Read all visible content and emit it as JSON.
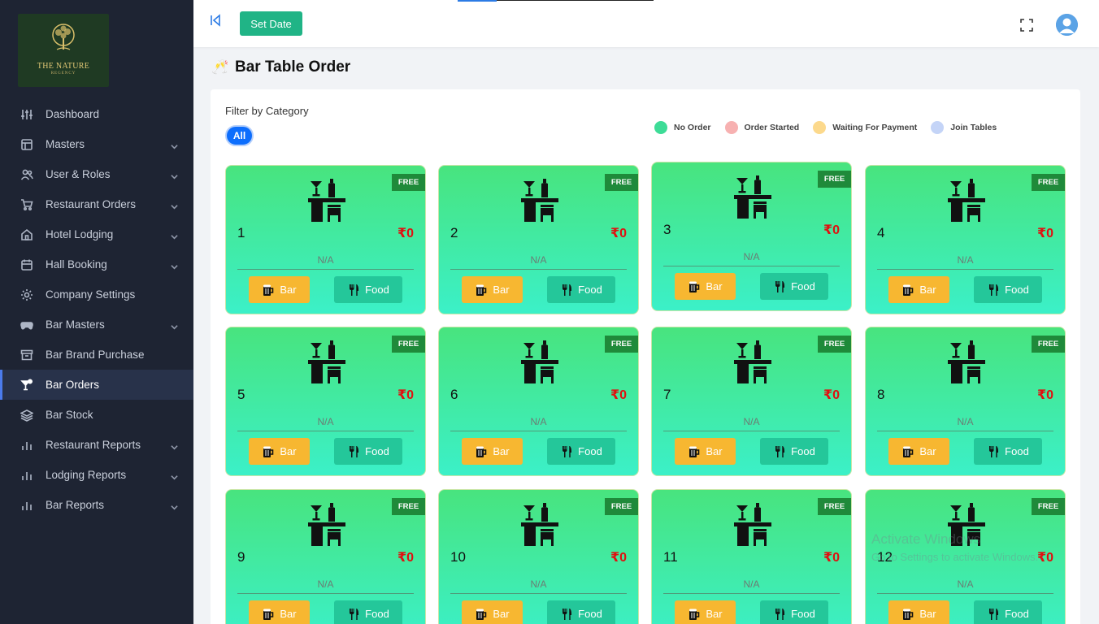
{
  "brand": {
    "name": "THE NATURE",
    "subtitle": "REGENCY"
  },
  "sidebar": {
    "items": [
      {
        "label": "Dashboard",
        "icon": "sliders-icon",
        "has_submenu": false,
        "active": false
      },
      {
        "label": "Masters",
        "icon": "layout-icon",
        "has_submenu": true,
        "active": false
      },
      {
        "label": "User & Roles",
        "icon": "users-icon",
        "has_submenu": true,
        "active": false
      },
      {
        "label": "Restaurant Orders",
        "icon": "cart-icon",
        "has_submenu": true,
        "active": false
      },
      {
        "label": "Hotel Lodging",
        "icon": "home-icon",
        "has_submenu": true,
        "active": false
      },
      {
        "label": "Hall Booking",
        "icon": "calendar-icon",
        "has_submenu": true,
        "active": false
      },
      {
        "label": "Company Settings",
        "icon": "gear-icon",
        "has_submenu": false,
        "active": false
      },
      {
        "label": "Bar Masters",
        "icon": "gamepad-icon",
        "has_submenu": true,
        "active": false
      },
      {
        "label": "Bar Brand Purchase",
        "icon": "archive-icon",
        "has_submenu": false,
        "active": false
      },
      {
        "label": "Bar Orders",
        "icon": "cocktail-icon",
        "has_submenu": false,
        "active": true
      },
      {
        "label": "Bar Stock",
        "icon": "layers-icon",
        "has_submenu": false,
        "active": false
      },
      {
        "label": "Restaurant Reports",
        "icon": "bar-chart-icon",
        "has_submenu": true,
        "active": false
      },
      {
        "label": "Lodging Reports",
        "icon": "bar-chart-icon",
        "has_submenu": true,
        "active": false
      },
      {
        "label": "Bar Reports",
        "icon": "bar-chart-icon",
        "has_submenu": true,
        "active": false
      }
    ]
  },
  "header": {
    "set_date_label": "Set Date"
  },
  "page": {
    "title": "Bar Table Order",
    "title_icon": "cheers-icon"
  },
  "filter": {
    "label": "Filter by Category",
    "chips": [
      "All"
    ]
  },
  "legend": [
    {
      "label": "No Order",
      "color": "#3ddc97"
    },
    {
      "label": "Order Started",
      "color": "#f7b1b1"
    },
    {
      "label": "Waiting For Payment",
      "color": "#fcd98c"
    },
    {
      "label": "Join Tables",
      "color": "#c4d4f7"
    }
  ],
  "tables": [
    {
      "number": "1",
      "amount": "₹0",
      "badge": "FREE",
      "status": "N/A",
      "bar_label": "Bar",
      "food_label": "Food"
    },
    {
      "number": "2",
      "amount": "₹0",
      "badge": "FREE",
      "status": "N/A",
      "bar_label": "Bar",
      "food_label": "Food"
    },
    {
      "number": "3",
      "amount": "₹0",
      "badge": "FREE",
      "status": "N/A",
      "bar_label": "Bar",
      "food_label": "Food"
    },
    {
      "number": "4",
      "amount": "₹0",
      "badge": "FREE",
      "status": "N/A",
      "bar_label": "Bar",
      "food_label": "Food"
    },
    {
      "number": "5",
      "amount": "₹0",
      "badge": "FREE",
      "status": "N/A",
      "bar_label": "Bar",
      "food_label": "Food"
    },
    {
      "number": "6",
      "amount": "₹0",
      "badge": "FREE",
      "status": "N/A",
      "bar_label": "Bar",
      "food_label": "Food"
    },
    {
      "number": "7",
      "amount": "₹0",
      "badge": "FREE",
      "status": "N/A",
      "bar_label": "Bar",
      "food_label": "Food"
    },
    {
      "number": "8",
      "amount": "₹0",
      "badge": "FREE",
      "status": "N/A",
      "bar_label": "Bar",
      "food_label": "Food"
    },
    {
      "number": "9",
      "amount": "₹0",
      "badge": "FREE",
      "status": "N/A",
      "bar_label": "Bar",
      "food_label": "Food"
    },
    {
      "number": "10",
      "amount": "₹0",
      "badge": "FREE",
      "status": "N/A",
      "bar_label": "Bar",
      "food_label": "Food"
    },
    {
      "number": "11",
      "amount": "₹0",
      "badge": "FREE",
      "status": "N/A",
      "bar_label": "Bar",
      "food_label": "Food"
    },
    {
      "number": "12",
      "amount": "₹0",
      "badge": "FREE",
      "status": "N/A",
      "bar_label": "Bar",
      "food_label": "Food"
    }
  ],
  "watermark": {
    "line1": "Activate Windows",
    "line2": "Go to Settings to activate Windows."
  }
}
